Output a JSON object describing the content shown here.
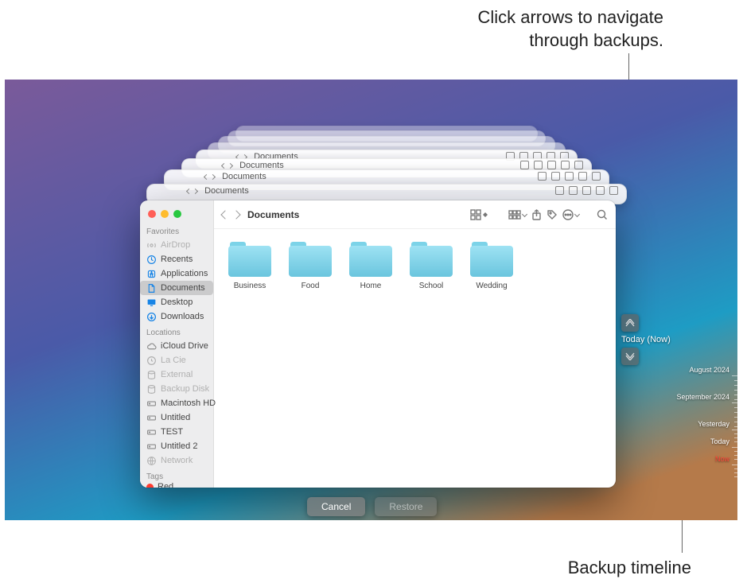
{
  "callouts": {
    "arrows": "Click arrows to navigate\nthrough backups.",
    "timeline": "Backup timeline"
  },
  "crumb": "Documents",
  "sidebar": {
    "favorites_head": "Favorites",
    "locations_head": "Locations",
    "tags_head": "Tags",
    "favorites": [
      {
        "label": "AirDrop",
        "icon": "airdrop-icon",
        "dim": true
      },
      {
        "label": "Recents",
        "icon": "clock-icon",
        "dim": false
      },
      {
        "label": "Applications",
        "icon": "applications-icon",
        "dim": false
      },
      {
        "label": "Documents",
        "icon": "document-icon",
        "dim": false,
        "active": true
      },
      {
        "label": "Desktop",
        "icon": "desktop-icon",
        "dim": false
      },
      {
        "label": "Downloads",
        "icon": "downloads-icon",
        "dim": false
      }
    ],
    "locations": [
      {
        "label": "iCloud Drive",
        "icon": "cloud-icon",
        "gray": true
      },
      {
        "label": "La Cie",
        "icon": "clock2-icon",
        "gray": true,
        "dim": true
      },
      {
        "label": "External",
        "icon": "disk-icon",
        "gray": true,
        "dim": true
      },
      {
        "label": "Backup Disk",
        "icon": "disk-icon",
        "gray": true,
        "dim": true
      },
      {
        "label": "Macintosh HD",
        "icon": "hd-icon",
        "gray": true
      },
      {
        "label": "Untitled",
        "icon": "hd-icon",
        "gray": true
      },
      {
        "label": "TEST",
        "icon": "hd-icon",
        "gray": true
      },
      {
        "label": "Untitled 2",
        "icon": "hd-icon",
        "gray": true
      },
      {
        "label": "Network",
        "icon": "globe-icon",
        "gray": true,
        "dim": true
      }
    ],
    "tags": [
      {
        "label": "Red",
        "color": "#ff3b30",
        "cut": true
      }
    ]
  },
  "folders": [
    "Business",
    "Food",
    "Home",
    "School",
    "Wedding"
  ],
  "nav": {
    "current": "Today (Now)"
  },
  "timeline": [
    {
      "label": "August 2024"
    },
    {
      "label": "September 2024"
    },
    {
      "label": "Yesterday",
      "compact": true
    },
    {
      "label": "Today",
      "compact": true
    },
    {
      "label": "Now",
      "compact": true,
      "now": true
    }
  ],
  "buttons": {
    "cancel": "Cancel",
    "restore": "Restore"
  }
}
